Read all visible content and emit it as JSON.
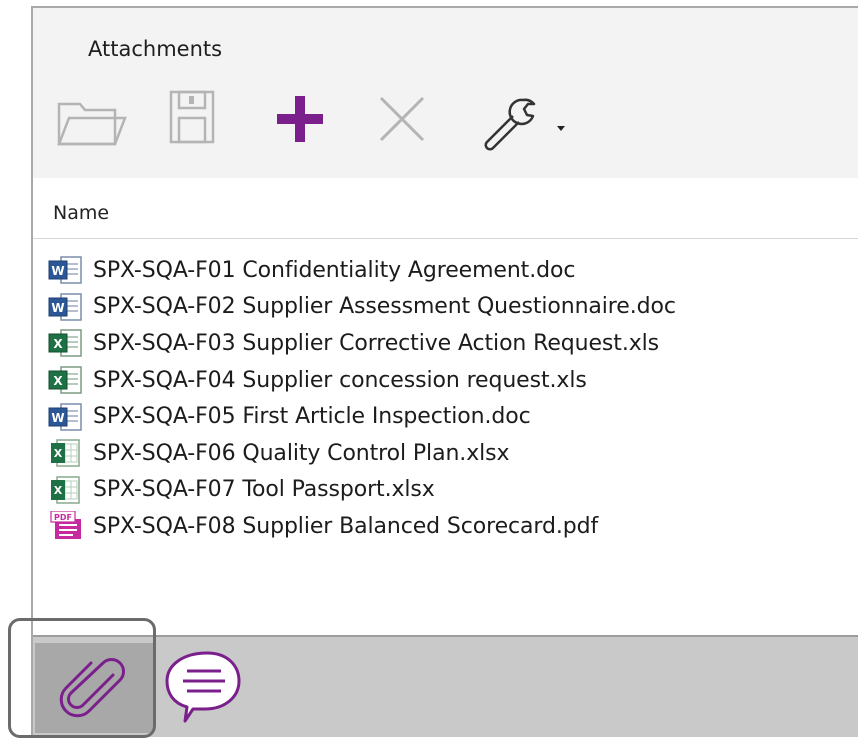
{
  "panel": {
    "title": "Attachments"
  },
  "toolbar": {
    "buttons": [
      {
        "name": "open",
        "icon": "folder-open-icon",
        "enabled": false
      },
      {
        "name": "save",
        "icon": "floppy-disk-icon",
        "enabled": false
      },
      {
        "name": "add",
        "icon": "plus-icon",
        "enabled": true,
        "color": "#7a1f8c"
      },
      {
        "name": "delete",
        "icon": "close-x-icon",
        "enabled": false
      },
      {
        "name": "options",
        "icon": "wrench-icon",
        "enabled": true,
        "has_dropdown": true
      }
    ]
  },
  "list": {
    "column_header": "Name",
    "files": [
      {
        "type": "doc",
        "icon": "word-doc-icon",
        "name": "SPX-SQA-F01 Confidentiality Agreement.doc"
      },
      {
        "type": "doc",
        "icon": "word-doc-icon",
        "name": "SPX-SQA-F02 Supplier Assessment Questionnaire.doc"
      },
      {
        "type": "xls",
        "icon": "excel-xls-icon",
        "name": "SPX-SQA-F03 Supplier Corrective Action Request.xls"
      },
      {
        "type": "xls",
        "icon": "excel-xls-icon",
        "name": "SPX-SQA-F04 Supplier concession request.xls"
      },
      {
        "type": "doc",
        "icon": "word-doc-icon",
        "name": "SPX-SQA-F05 First Article Inspection.doc"
      },
      {
        "type": "xlsx",
        "icon": "excel-xlsx-icon",
        "name": "SPX-SQA-F06 Quality Control Plan.xlsx"
      },
      {
        "type": "xlsx",
        "icon": "excel-xlsx-icon",
        "name": "SPX-SQA-F07 Tool Passport.xlsx"
      },
      {
        "type": "pdf",
        "icon": "pdf-icon",
        "name": "SPX-SQA-F08 Supplier Balanced Scorecard.pdf"
      }
    ]
  },
  "bottom_tabs": [
    {
      "name": "attachments",
      "icon": "paperclip-icon",
      "active": true
    },
    {
      "name": "comments",
      "icon": "speech-bubble-icon",
      "active": false
    }
  ],
  "colors": {
    "accent": "#7a1f8c",
    "word_blue": "#2b5797",
    "excel_green": "#1e7145",
    "disabled_gray": "#b4b4b4"
  }
}
